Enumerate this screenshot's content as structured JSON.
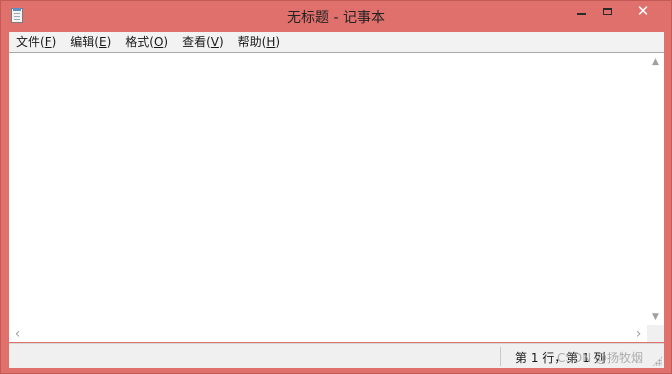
{
  "window": {
    "title": "无标题 - 记事本",
    "icon": "notepad-icon",
    "controls": {
      "minimize": "minimize-icon",
      "maximize": "maximize-icon",
      "close": "✕"
    }
  },
  "menubar": {
    "items": [
      {
        "label": "文件(",
        "key": "F",
        "suffix": ")"
      },
      {
        "label": "编辑(",
        "key": "E",
        "suffix": ")"
      },
      {
        "label": "格式(",
        "key": "O",
        "suffix": ")"
      },
      {
        "label": "查看(",
        "key": "V",
        "suffix": ")"
      },
      {
        "label": "帮助(",
        "key": "H",
        "suffix": ")"
      }
    ]
  },
  "editor": {
    "content": ""
  },
  "scrollbars": {
    "up": "▲",
    "down": "▼",
    "left": "‹",
    "right": "›"
  },
  "statusbar": {
    "position": "第 1 行，第 1 列",
    "watermark": "CSDN @扬牧烟"
  },
  "colors": {
    "frame": "#e0706c",
    "menubar": "#f2f2f2",
    "editor": "#ffffff",
    "statusbar": "#f0f0f0"
  }
}
